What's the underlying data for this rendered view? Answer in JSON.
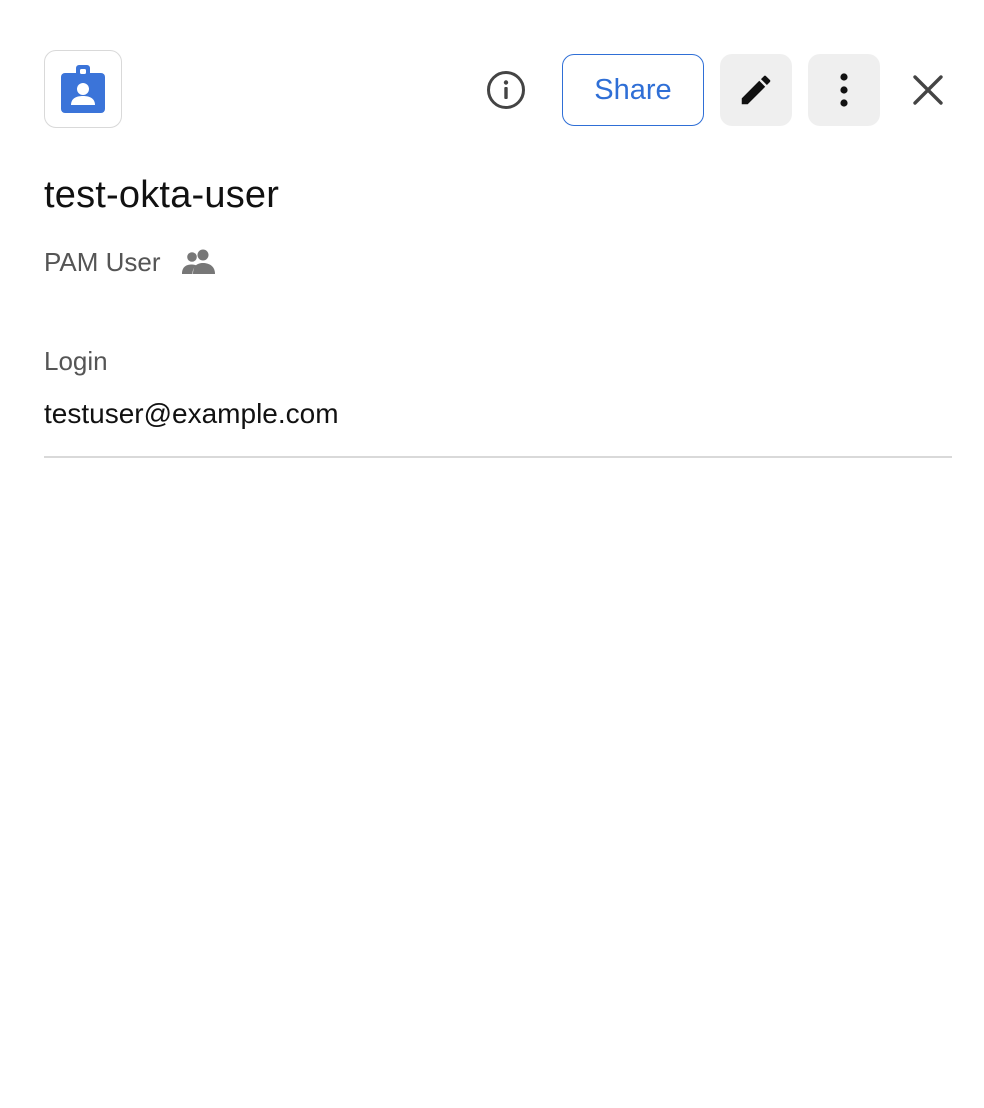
{
  "header": {
    "record_icon": "contact-badge-icon",
    "info_icon": "info-icon",
    "share_label": "Share",
    "edit_icon": "pencil-icon",
    "more_icon": "more-vertical-icon",
    "close_icon": "close-icon"
  },
  "record": {
    "title": "test-okta-user",
    "type": "PAM User",
    "shared_icon": "shared-users-icon"
  },
  "fields": [
    {
      "label": "Login",
      "value": "testuser@example.com"
    }
  ],
  "colors": {
    "accent": "#2f6fd6",
    "icon_blue": "#3b74d9",
    "button_bg": "#efefef",
    "muted_text": "#555555",
    "divider": "#d9d9d9"
  }
}
